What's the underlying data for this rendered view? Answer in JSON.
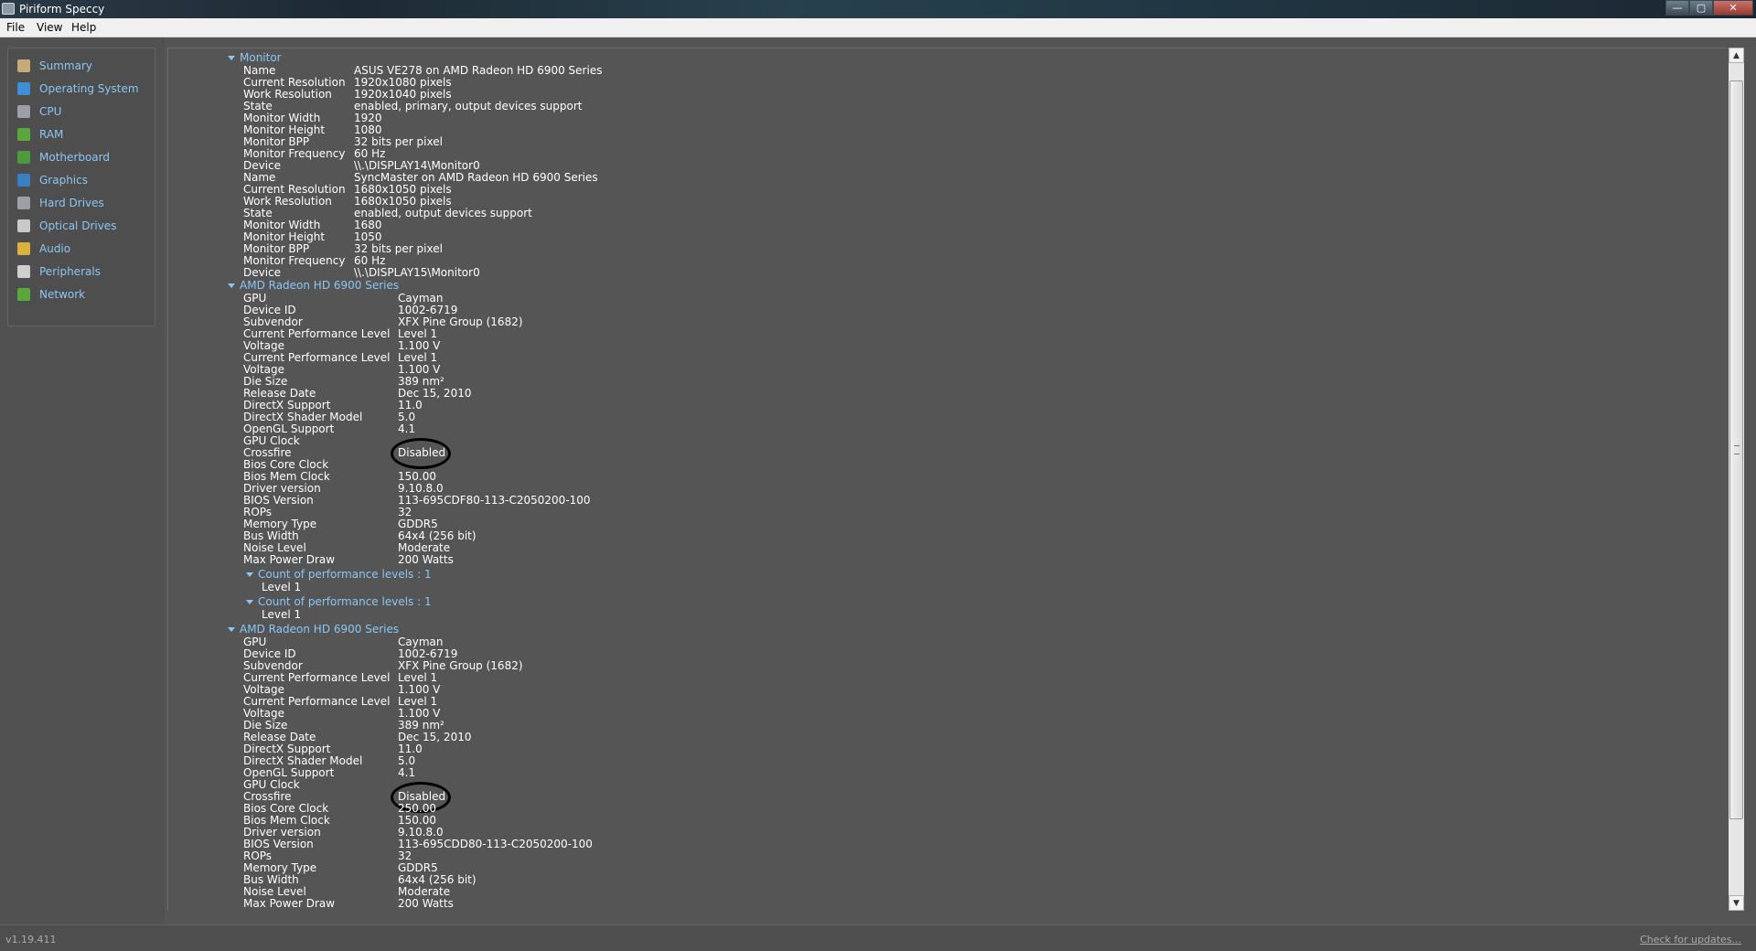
{
  "window": {
    "title": "Piriform Speccy",
    "minimize": "—",
    "maximize": "▢",
    "close": "✕"
  },
  "menu": [
    "File",
    "View",
    "Help"
  ],
  "sidebar": [
    {
      "label": "Summary",
      "icon": "summary-icon",
      "color": "#c8a978"
    },
    {
      "label": "Operating System",
      "icon": "windows-logo-icon",
      "color": "#3f8fd8"
    },
    {
      "label": "CPU",
      "icon": "cpu-chip-icon",
      "color": "#9aa0a6"
    },
    {
      "label": "RAM",
      "icon": "ram-module-icon",
      "color": "#5aa83a"
    },
    {
      "label": "Motherboard",
      "icon": "motherboard-icon",
      "color": "#4f9a3e"
    },
    {
      "label": "Graphics",
      "icon": "graphics-monitor-icon",
      "color": "#3a7fc4"
    },
    {
      "label": "Hard Drives",
      "icon": "hard-drive-icon",
      "color": "#9aa0a6"
    },
    {
      "label": "Optical Drives",
      "icon": "optical-disc-icon",
      "color": "#c9c9c9"
    },
    {
      "label": "Audio",
      "icon": "speaker-icon",
      "color": "#d8b23c"
    },
    {
      "label": "Peripherals",
      "icon": "mouse-icon",
      "color": "#cfcfcf"
    },
    {
      "label": "Network",
      "icon": "network-icon",
      "color": "#5aa83a"
    }
  ],
  "sections": [
    {
      "title": "Monitor",
      "rows": [
        [
          "Name",
          "ASUS VE278 on AMD Radeon HD 6900 Series"
        ],
        [
          "Current Resolution",
          "1920x1080 pixels"
        ],
        [
          "Work Resolution",
          "1920x1040 pixels"
        ],
        [
          "State",
          "enabled, primary, output devices support"
        ],
        [
          "Monitor Width",
          "1920"
        ],
        [
          "Monitor Height",
          "1080"
        ],
        [
          "Monitor BPP",
          "32 bits per pixel"
        ],
        [
          "Monitor Frequency",
          "60 Hz"
        ],
        [
          "Device",
          "\\\\.\\DISPLAY14\\Monitor0"
        ],
        [
          "Name",
          "SyncMaster on AMD Radeon HD 6900 Series"
        ],
        [
          "Current Resolution",
          "1680x1050 pixels"
        ],
        [
          "Work Resolution",
          "1680x1050 pixels"
        ],
        [
          "State",
          "enabled, output devices support"
        ],
        [
          "Monitor Width",
          "1680"
        ],
        [
          "Monitor Height",
          "1050"
        ],
        [
          "Monitor BPP",
          "32 bits per pixel"
        ],
        [
          "Monitor Frequency",
          "60 Hz"
        ],
        [
          "Device",
          "\\\\.\\DISPLAY15\\Monitor0"
        ]
      ]
    },
    {
      "title": "AMD Radeon HD 6900 Series",
      "rows": [
        [
          "GPU",
          "Cayman"
        ],
        [
          "Device ID",
          "1002-6719"
        ],
        [
          "Subvendor",
          "XFX Pine Group (1682)"
        ],
        [
          "Current Performance Level",
          "Level 1"
        ],
        [
          "Voltage",
          "1.100 V"
        ],
        [
          "Current Performance Level",
          "Level 1"
        ],
        [
          "Voltage",
          "1.100 V"
        ],
        [
          "Die Size",
          "389 nm²"
        ],
        [
          "Release Date",
          "Dec 15, 2010"
        ],
        [
          "DirectX Support",
          "11.0"
        ],
        [
          "DirectX Shader Model",
          "5.0"
        ],
        [
          "OpenGL Support",
          "4.1"
        ],
        [
          "GPU Clock",
          ""
        ],
        [
          "Crossfire",
          "Disabled"
        ],
        [
          "Bios Core Clock",
          ""
        ],
        [
          "Bios Mem Clock",
          "150.00"
        ],
        [
          "Driver version",
          "9.10.8.0"
        ],
        [
          "BIOS Version",
          "113-695CDF80-113-C2050200-100"
        ],
        [
          "ROPs",
          "32"
        ],
        [
          "Memory Type",
          "GDDR5"
        ],
        [
          "Bus Width",
          "64x4 (256 bit)"
        ],
        [
          "Noise Level",
          "Moderate"
        ],
        [
          "Max Power Draw",
          "200 Watts"
        ]
      ],
      "subsections": [
        {
          "title": "Count of performance levels : 1",
          "rows": [
            "Level 1"
          ]
        },
        {
          "title": "Count of performance levels : 1",
          "rows": [
            "Level 1"
          ]
        }
      ]
    },
    {
      "title": "AMD Radeon HD 6900 Series",
      "rows": [
        [
          "GPU",
          "Cayman"
        ],
        [
          "Device ID",
          "1002-6719"
        ],
        [
          "Subvendor",
          "XFX Pine Group (1682)"
        ],
        [
          "Current Performance Level",
          "Level 1"
        ],
        [
          "Voltage",
          "1.100 V"
        ],
        [
          "Current Performance Level",
          "Level 1"
        ],
        [
          "Voltage",
          "1.100 V"
        ],
        [
          "Die Size",
          "389 nm²"
        ],
        [
          "Release Date",
          "Dec 15, 2010"
        ],
        [
          "DirectX Support",
          "11.0"
        ],
        [
          "DirectX Shader Model",
          "5.0"
        ],
        [
          "OpenGL Support",
          "4.1"
        ],
        [
          "GPU Clock",
          ""
        ],
        [
          "Crossfire",
          "Disabled"
        ],
        [
          "Bios Core Clock",
          "250.00"
        ],
        [
          "Bios Mem Clock",
          "150.00"
        ],
        [
          "Driver version",
          "9.10.8.0"
        ],
        [
          "BIOS Version",
          "113-695CDD80-113-C2050200-100"
        ],
        [
          "ROPs",
          "32"
        ],
        [
          "Memory Type",
          "GDDR5"
        ],
        [
          "Bus Width",
          "64x4 (256 bit)"
        ],
        [
          "Noise Level",
          "Moderate"
        ],
        [
          "Max Power Draw",
          "200 Watts"
        ]
      ]
    }
  ],
  "status": {
    "version": "v1.19.411",
    "updates": "Check for updates..."
  },
  "colors": {
    "accent": "#8cc6f4",
    "background": "#555555"
  }
}
